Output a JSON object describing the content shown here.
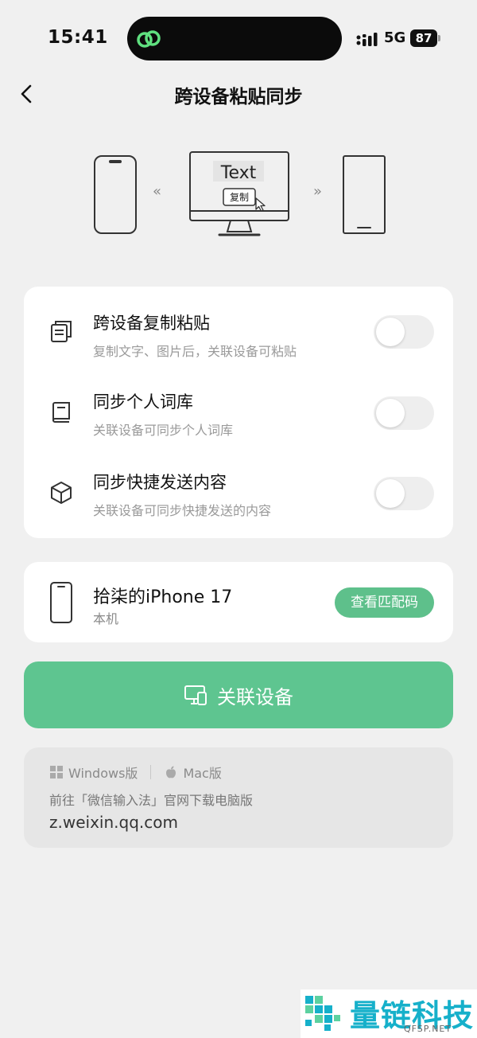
{
  "status_bar": {
    "time": "15:41",
    "network": "5G",
    "battery": "87"
  },
  "header": {
    "title": "跨设备粘贴同步"
  },
  "illustration": {
    "text_label": "Text",
    "copy_label": "复制"
  },
  "settings": [
    {
      "title": "跨设备复制粘贴",
      "desc": "复制文字、图片后，关联设备可粘贴",
      "icon": "copy-icon",
      "enabled": false
    },
    {
      "title": "同步个人词库",
      "desc": "关联设备可同步个人词库",
      "icon": "book-icon",
      "enabled": false
    },
    {
      "title": "同步快捷发送内容",
      "desc": "关联设备可同步快捷发送的内容",
      "icon": "cube-icon",
      "enabled": false
    }
  ],
  "device": {
    "name": "拾柒的iPhone 17",
    "sub": "本机",
    "button": "查看匹配码"
  },
  "link_button": {
    "label": "关联设备"
  },
  "download": {
    "windows": "Windows版",
    "mac": "Mac版",
    "text": "前往「微信输入法」官网下载电脑版",
    "url": "z.weixin.qq.com"
  },
  "watermark": {
    "text": "量链科技",
    "sub": "QFSP.NET"
  },
  "colors": {
    "accent": "#5ec590",
    "background": "#f0f0f0"
  }
}
